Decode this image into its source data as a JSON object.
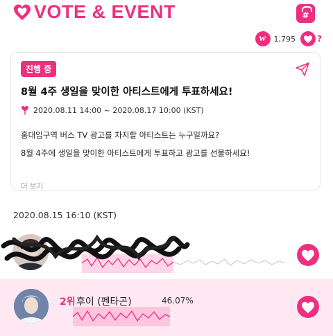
{
  "header": {
    "title": "VOTE & EVENT",
    "hash_label": "#"
  },
  "points": {
    "value": "1,795",
    "w_label": "w",
    "help": "?"
  },
  "event": {
    "status": "진행 중",
    "title": "8월 4주 생일을 맞이한 아티스트에게 투표하세요!",
    "period": "2020.08.11 14:00 ~ 2020.08.17 10:00 (KST)",
    "description": [
      "홍대입구역 버스 TV 광고를 차지할 아티스트는 누구일까요?",
      "8월 4주에 생일을 맞이한 아티스트에게 투표하고 광고를 선물하세요!"
    ],
    "more": "더 보기"
  },
  "timestamp": "2020.08.15 16:10 (KST)",
  "rankings": [
    {
      "rank": "",
      "name": "",
      "percent": ""
    },
    {
      "rank": "2위",
      "name": "후이 (펜타곤)",
      "percent": "46.07%"
    }
  ],
  "colors": {
    "accent": "#ee2f7f",
    "row_highlight": "#ffe8f2"
  }
}
